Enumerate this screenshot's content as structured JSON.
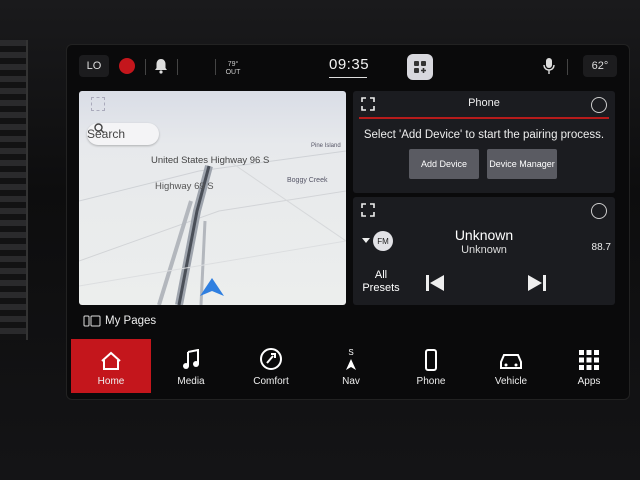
{
  "status_bar": {
    "lo_label": "LO",
    "temp_value": "79°",
    "temp_unit": "OUT",
    "clock": "09:35",
    "outside_temp": "62°"
  },
  "map": {
    "search_placeholder": "Search",
    "road_label_1": "United States Highway 96 S",
    "road_label_2": "Highway 69 S",
    "place_1": "Pine Island",
    "place_2": "Boggy Creek"
  },
  "phone": {
    "title": "Phone",
    "message": "Select 'Add Device' to start the pairing process.",
    "add_device": "Add Device",
    "device_manager": "Device Manager"
  },
  "media": {
    "band": "FM",
    "title": "Unknown",
    "subtitle": "Unknown",
    "frequency": "88.7",
    "all_presets_line1": "All",
    "all_presets_line2": "Presets"
  },
  "my_pages": "My Pages",
  "nav": [
    {
      "label": "Home",
      "icon": "home-icon",
      "active": true
    },
    {
      "label": "Media",
      "icon": "music-note-icon"
    },
    {
      "label": "Comfort",
      "icon": "comfort-icon"
    },
    {
      "label": "Nav",
      "icon": "compass-icon"
    },
    {
      "label": "Phone",
      "icon": "phone-icon"
    },
    {
      "label": "Vehicle",
      "icon": "car-icon"
    },
    {
      "label": "Apps",
      "icon": "grid-icon"
    }
  ],
  "colors": {
    "accent": "#c4161c",
    "panel_bg": "#1b1c20",
    "button_bg": "#5a5b62"
  }
}
